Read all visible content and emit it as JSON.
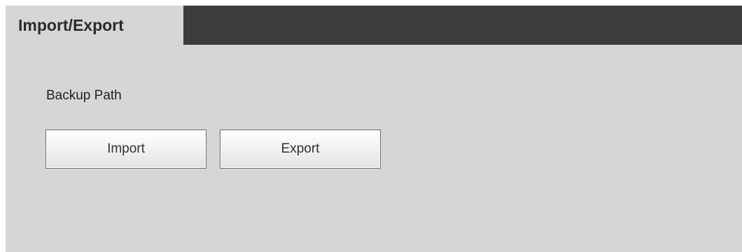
{
  "tabs": [
    {
      "label": "Import/Export",
      "active": true
    }
  ],
  "content": {
    "section_label": "Backup Path",
    "buttons": {
      "import_label": "Import",
      "export_label": "Export"
    }
  },
  "colors": {
    "tabbar_background": "#3c3c3c",
    "panel_background": "#d6d6d6",
    "text": "#222222"
  }
}
